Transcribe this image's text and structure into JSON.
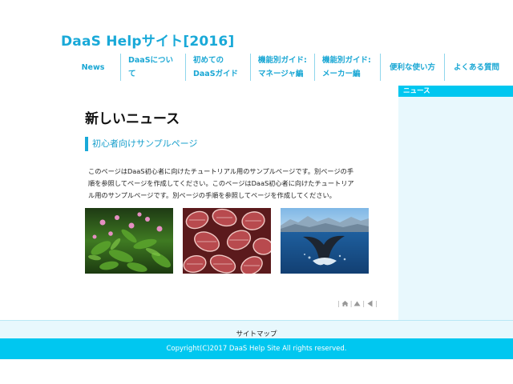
{
  "header": {
    "site_title": "DaaS Helpサイト[2016]"
  },
  "nav": [
    {
      "line1": "News",
      "line2": ""
    },
    {
      "line1": "DaaSについ",
      "line2": "て"
    },
    {
      "line1": "初めての",
      "line2": "DaaSガイド"
    },
    {
      "line1": "機能別ガイド:",
      "line2": "マネージャ編"
    },
    {
      "line1": "機能別ガイド:",
      "line2": "メーカー編"
    },
    {
      "line1": "便利な使い方",
      "line2": ""
    },
    {
      "line1": "よくある質問",
      "line2": ""
    }
  ],
  "sidebar": {
    "heading": "ニュース"
  },
  "main": {
    "heading": "新しいニュース",
    "subheading": "初心者向けサンプルページ",
    "lines": [
      "このページはDaaS初心者に向けたチュートリアル用のサンプルページです。別ページの手",
      "順を参照してページを作成してください。このページはDaaS初心者に向けたチュートリア",
      "ル用のサンプルページです。別ページの手順を参照してページを作成してください。"
    ],
    "photos": [
      "flowers-photo",
      "red-leaves-photo",
      "whale-tail-photo"
    ]
  },
  "pager": {
    "icons": [
      "home-icon",
      "up-arrow-icon",
      "back-arrow-icon"
    ]
  },
  "footer": {
    "sitemap": "サイトマップ",
    "copyright": "Copyright(C)2017 DaaS Help Site All rights reserved."
  },
  "colors": {
    "accent": "#19a9d8",
    "bar": "#00c7f0",
    "sidebar_bg": "#e8f8fd"
  }
}
